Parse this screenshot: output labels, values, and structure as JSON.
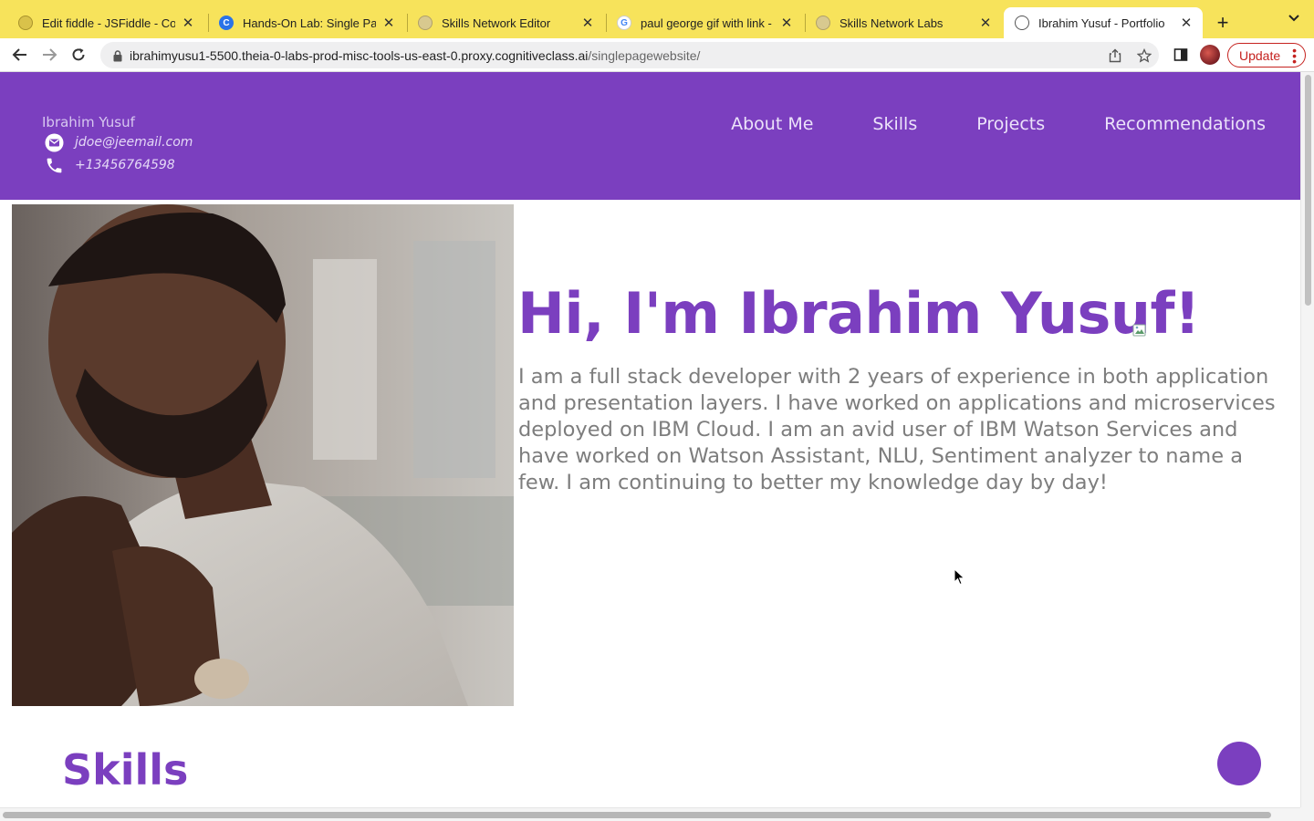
{
  "browser": {
    "tabs": [
      {
        "title": "Edit fiddle - JSFiddle - Cod",
        "icon": "jsfiddle-icon"
      },
      {
        "title": "Hands-On Lab: Single Page",
        "icon": "coursera-icon"
      },
      {
        "title": "Skills Network Editor",
        "icon": "skills-network-icon"
      },
      {
        "title": "paul george gif with link - G",
        "icon": "google-icon"
      },
      {
        "title": "Skills Network Labs",
        "icon": "skills-network-icon"
      },
      {
        "title": "Ibrahim Yusuf - Portfolio",
        "icon": "globe-icon",
        "active": true
      }
    ],
    "url_host": "ibrahimyusu1-5500.theia-0-labs-prod-misc-tools-us-east-0.proxy.cognitiveclass.ai",
    "url_path": "/singlepagewebsite/",
    "update_label": "Update",
    "accent": "#f7e35b"
  },
  "page": {
    "header": {
      "name": "Ibrahim Yusuf",
      "email": "jdoe@jeemail.com",
      "phone": "+13456764598",
      "nav": [
        "About Me",
        "Skills",
        "Projects",
        "Recommendations"
      ]
    },
    "hero": {
      "title": "Hi, I'm Ibrahim Yusuf!",
      "about": "I am a full stack developer with 2 years of experience in both application and presentation layers. I have worked on applications and microservices deployed on IBM Cloud. I am an avid user of IBM Watson Services and have worked on Watson Assistant, NLU, Sentiment analyzer to name a few. I am continuing to better my knowledge day by day!"
    },
    "skills_heading": "Skills",
    "brand_color": "#7b3fbf"
  }
}
